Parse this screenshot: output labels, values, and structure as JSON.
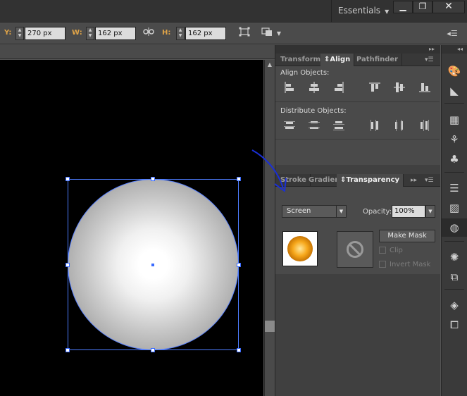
{
  "titlebar": {
    "workspace": "Essentials",
    "minimize_glyph": "▁",
    "maximize_glyph": "❐",
    "close_glyph": "✕"
  },
  "control_bar": {
    "y_label": "Y:",
    "y_value": "270 px",
    "w_label": "W:",
    "w_value": "162 px",
    "h_label": "H:",
    "h_value": "162 px",
    "constrain_icon": "link-icon",
    "transform_icon": "transform-icon",
    "isolate_icon": "isolate-icon",
    "menu_icon": "panel-menu-icon"
  },
  "align_panel": {
    "tabs": [
      {
        "label": "Transform",
        "active": false
      },
      {
        "label": "Align",
        "active": true
      },
      {
        "label": "Pathfinder",
        "active": false
      }
    ],
    "align_objects_label": "Align Objects:",
    "distribute_objects_label": "Distribute Objects:"
  },
  "transparency_panel": {
    "tabs": [
      {
        "label": "Stroke",
        "active": false
      },
      {
        "label": "Gradien",
        "active": false
      },
      {
        "label": "Transparency",
        "active": true
      }
    ],
    "blend_mode": "Screen",
    "opacity_label": "Opacity:",
    "opacity_value": "100%",
    "make_mask_label": "Make Mask",
    "clip_label": "Clip",
    "invert_mask_label": "Invert Mask"
  },
  "dock": {
    "icons": [
      "color-guide-icon",
      "color-icon",
      "swatches-icon",
      "brushes-icon",
      "symbols-icon",
      "stroke-icon",
      "gradient-icon",
      "transparency-icon",
      "appearance-icon",
      "graphic-styles-icon",
      "layers-icon",
      "artboards-icon"
    ]
  },
  "colors": {
    "selection": "#4d7cff",
    "annotation_arrow": "#1a2fd6",
    "panel_bg": "#4a4a4a",
    "canvas_bg": "#000000"
  }
}
